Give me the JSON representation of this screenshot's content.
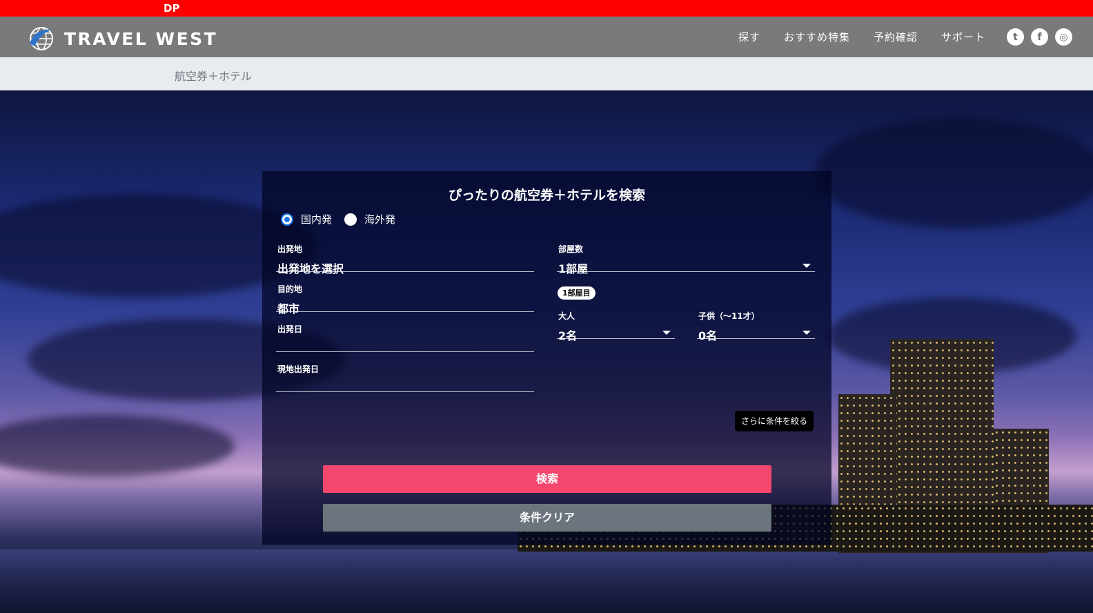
{
  "env": {
    "label": "DP"
  },
  "header": {
    "brand": "TRAVEL WEST",
    "nav": [
      {
        "label": "探す"
      },
      {
        "label": "おすすめ特集"
      },
      {
        "label": "予約確認"
      },
      {
        "label": "サポート"
      }
    ],
    "social": [
      {
        "icon": "twitter-icon",
        "glyph": "t"
      },
      {
        "icon": "facebook-icon",
        "glyph": "f"
      },
      {
        "icon": "instagram-icon",
        "glyph": "◎"
      }
    ]
  },
  "breadcrumb": {
    "label": "航空券＋ホテル"
  },
  "search": {
    "title": "ぴったりの航空券＋ホテルを検索",
    "radios": [
      {
        "label": "国内発",
        "checked": true
      },
      {
        "label": "海外発",
        "checked": false
      }
    ],
    "departure": {
      "label": "出発地",
      "value": "出発地を選択"
    },
    "destination": {
      "label": "目的地",
      "value": "都市"
    },
    "depart_date": {
      "label": "出発日",
      "value": ""
    },
    "local_depart_date": {
      "label": "現地出発日",
      "value": ""
    },
    "rooms": {
      "label": "部屋数",
      "value": "1部屋"
    },
    "room_badge": "1部屋目",
    "adults": {
      "label": "大人",
      "value": "2名"
    },
    "children": {
      "label": "子供（〜11才）",
      "value": "0名"
    },
    "more_filters": "さらに条件を絞る",
    "search_button": "検索",
    "clear_button": "条件クリア"
  },
  "colors": {
    "env_bar": "#ff0000",
    "header": "#7a7a7a",
    "search_button": "#f5476e",
    "clear_button": "#6c757d"
  }
}
